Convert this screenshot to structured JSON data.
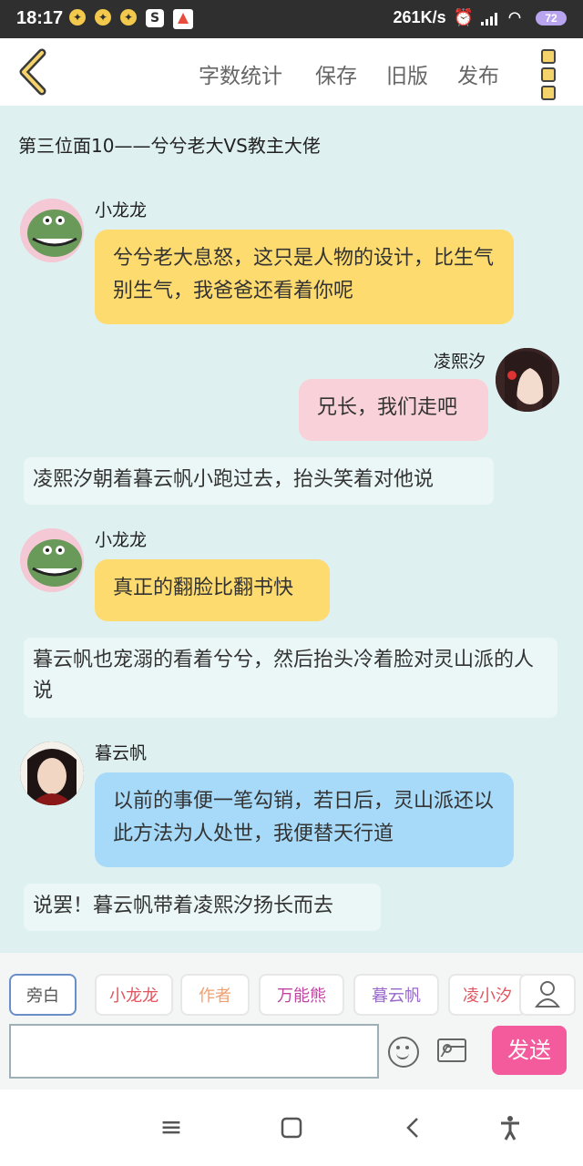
{
  "status_bar": {
    "time": "18:17",
    "speed": "261K/s",
    "battery": "72",
    "icons": [
      "notification-icon",
      "notification-icon",
      "notification-icon",
      "sogou-icon",
      "app-icon"
    ]
  },
  "topbar": {
    "menu": [
      "字数统计",
      "保存",
      "旧版",
      "发布"
    ]
  },
  "doc": {
    "title": "第三位面10——兮兮老大VS教主大佬"
  },
  "messages": [
    {
      "kind": "speech",
      "side": "left",
      "name": "小龙龙",
      "color": "yellow",
      "text": "兮兮老大息怒，这只是人物的设计，比生气别生气，我爸爸还看着你呢"
    },
    {
      "kind": "speech",
      "side": "right",
      "name": "凌熙汐",
      "color": "pink",
      "text": "兄长，我们走吧"
    },
    {
      "kind": "narration",
      "text": "凌熙汐朝着暮云帆小跑过去，抬头笑着对他说"
    },
    {
      "kind": "speech",
      "side": "left",
      "name": "小龙龙",
      "color": "yellow",
      "text": "真正的翻脸比翻书快"
    },
    {
      "kind": "narration",
      "text": "暮云帆也宠溺的看着兮兮，然后抬头冷着脸对灵山派的人说"
    },
    {
      "kind": "speech",
      "side": "left",
      "name": "暮云帆",
      "color": "blue",
      "text": "以前的事便一笔勾销，若日后，灵山派还以此方法为人处世，我便替天行道"
    },
    {
      "kind": "narration",
      "text": "说罢！暮云帆带着凌熙汐扬长而去"
    }
  ],
  "roles": [
    {
      "label": "旁白",
      "color": "#555555",
      "selected": true
    },
    {
      "label": "小龙龙",
      "color": "#e0555f"
    },
    {
      "label": "作者",
      "color": "#f0a070"
    },
    {
      "label": "万能熊",
      "color": "#c044a0"
    },
    {
      "label": "暮云帆",
      "color": "#9966cc"
    },
    {
      "label": "凌小汐",
      "color": "#e0555f"
    }
  ],
  "composer": {
    "send_label": "发送",
    "input_value": ""
  },
  "colors": {
    "bg": "#dff0f0",
    "accent": "#f45b9c"
  }
}
